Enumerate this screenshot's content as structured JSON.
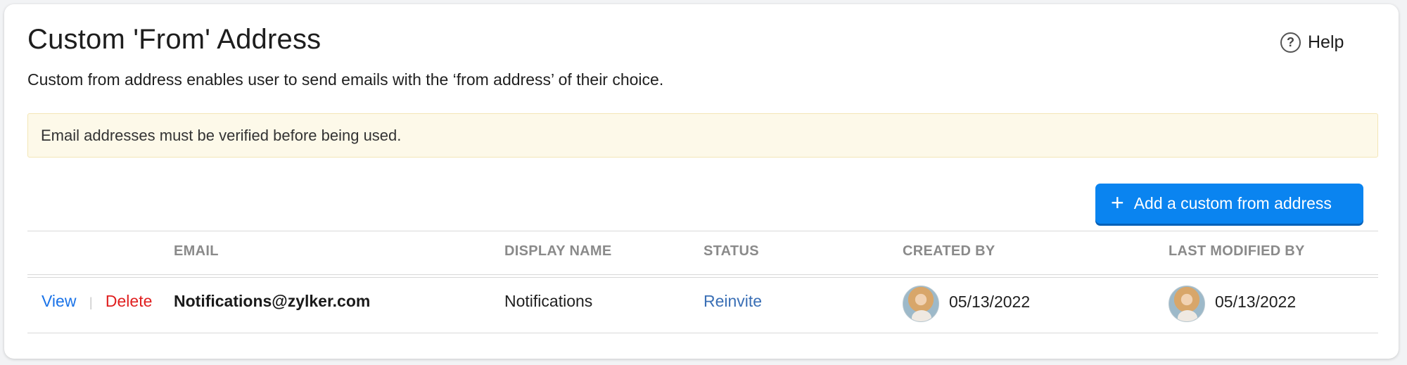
{
  "header": {
    "title": "Custom 'From' Address",
    "help_label": "Help",
    "help_icon": "help-circle-icon",
    "description": "Custom from address enables user to send emails with the ‘from address’ of their choice."
  },
  "notice": {
    "text": "Email addresses must be verified before being used."
  },
  "toolbar": {
    "add_icon": "plus-icon",
    "add_label": "Add a custom from address",
    "accent_color": "#0a84f0"
  },
  "table": {
    "columns": [
      "EMAIL",
      "DISPLAY NAME",
      "STATUS",
      "CREATED BY",
      "LAST MODIFIED BY"
    ],
    "rows": [
      {
        "actions": {
          "view": "View",
          "delete": "Delete"
        },
        "email": "Notifications@zylker.com",
        "display_name": "Notifications",
        "status": "Reinvite",
        "created_by": {
          "avatar_icon": "user-avatar",
          "date": "05/13/2022"
        },
        "last_modified_by": {
          "avatar_icon": "user-avatar",
          "date": "05/13/2022"
        }
      }
    ]
  }
}
